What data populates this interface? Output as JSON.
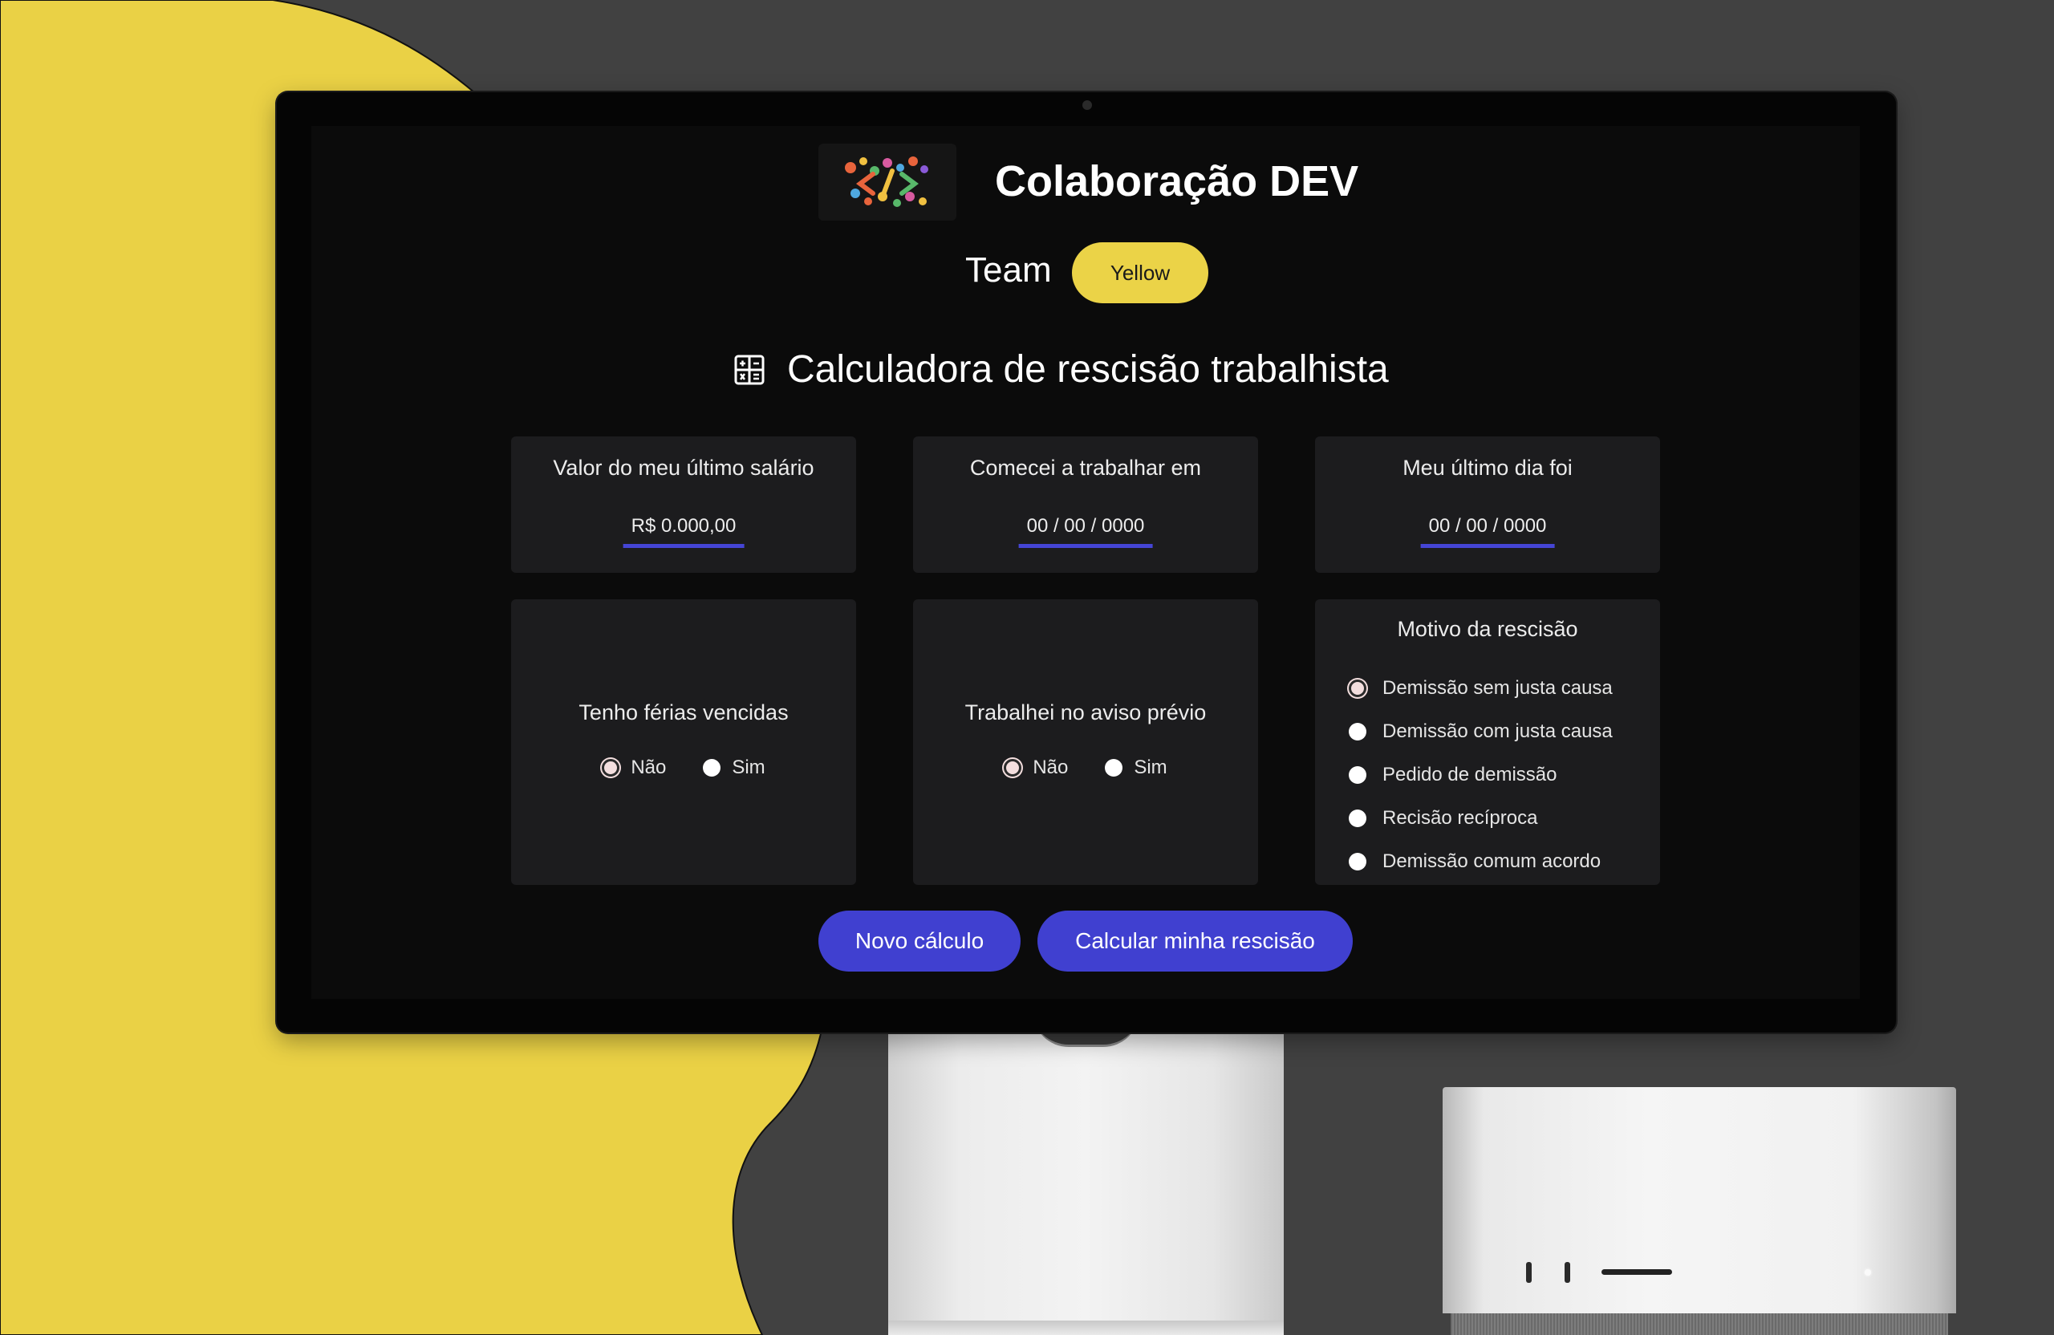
{
  "header": {
    "title": "Colaboração DEV",
    "team_label": "Team",
    "team_name": "Yellow"
  },
  "calculator": {
    "title": "Calculadora de rescisão trabalhista",
    "salary": {
      "label": "Valor do meu último salário",
      "placeholder": "R$ 0.000,00"
    },
    "start_date": {
      "label": "Comecei a trabalhar em",
      "placeholder": "00 / 00 / 0000"
    },
    "end_date": {
      "label": "Meu último dia foi",
      "placeholder": "00 / 00 / 0000"
    },
    "vacation": {
      "label": "Tenho férias vencidas",
      "options": [
        "Não",
        "Sim"
      ],
      "selected": "Não"
    },
    "notice": {
      "label": "Trabalhei no aviso prévio",
      "options": [
        "Não",
        "Sim"
      ],
      "selected": "Não"
    },
    "reason": {
      "label": "Motivo da rescisão",
      "options": [
        "Demissão sem justa causa",
        "Demissão com justa causa",
        "Pedido de demissão",
        "Recisão recíproca",
        "Demissão comum acordo"
      ],
      "selected": "Demissão sem justa causa"
    },
    "buttons": {
      "reset": "Novo cálculo",
      "submit": "Calcular minha rescisão"
    }
  },
  "colors": {
    "accent": "#4040d0",
    "brand_yellow": "#ebd347",
    "card_bg": "#1c1c1e",
    "screen_bg": "#0b0b0b"
  },
  "icons": {
    "calculator": "calculator-icon",
    "logo": "colorful-code-logo"
  }
}
